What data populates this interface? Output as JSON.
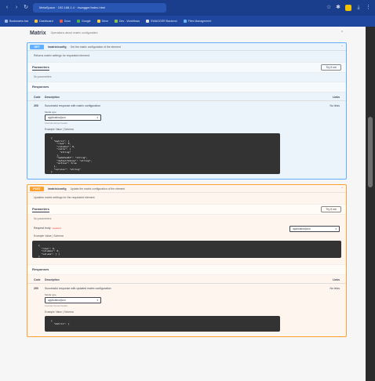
{
  "browser": {
    "tab_title": "MetaSpace · 192.168.1.4 · /swagger/index.html",
    "bookmarks": [
      {
        "label": "Bookmarks bar",
        "color": "#9fb6e6"
      },
      {
        "label": "Dashboard",
        "color": "#f4c542"
      },
      {
        "label": "Docs",
        "color": "#e25b4b"
      },
      {
        "label": "Google",
        "color": "#4caf50"
      },
      {
        "label": "Drive",
        "color": "#ffd54f"
      },
      {
        "label": "Dev - Workflows",
        "color": "#8bc34a"
      },
      {
        "label": "SWAGGER Backend",
        "color": "#e0e0e0"
      },
      {
        "label": "Files Management",
        "color": "#64b5f6"
      }
    ]
  },
  "section": {
    "title": "Matrix",
    "description": "Operations about matrix configuration"
  },
  "op_get": {
    "method": "GET",
    "path": "/matrix/config",
    "summary": "Get the matrix configuration of the element",
    "description": "Returns matrix settings for requested element.",
    "parameters_label": "Parameters",
    "try_label": "Try it out",
    "no_params": "No parameters",
    "responses_label": "Responses",
    "resp_cols": {
      "code": "Code",
      "desc": "Description",
      "links": "Links"
    },
    "resp_code": "200",
    "resp_desc": "Successful response with matrix configuration",
    "resp_links": "No links",
    "media_label": "Media type",
    "media_value": "application/json",
    "media_hint": "Controls Accept header.",
    "example_label": "Example Value | Schema",
    "code_lines": [
      "{",
      "  \"matrix\": {",
      "    \"rows\": 0,",
      "    \"columns\": 0,",
      "    \"cells\": [",
      "      \"string\"",
      "    ],",
      "    \"updatedAt\": \"string\",",
      "    \"defaultValue\": \"string\",",
      "    \"active\": true",
      "  },",
      "  \"version\": \"string\"",
      "}",
      "",
      "",
      "",
      "  ]",
      "}"
    ]
  },
  "op_post": {
    "method": "POST",
    "path": "/matrix/config",
    "summary": "Update the matrix configuration of the element",
    "description": "Updates matrix settings for the requested element.",
    "parameters_label": "Parameters",
    "try_label": "Try it out",
    "no_params": "No parameters",
    "body_label": "Request body",
    "body_required": "required",
    "body_select": "application/json",
    "example_label": "Example Value | Schema",
    "code_lines": [
      "{",
      "  \"rows\": 0,",
      "  \"columns\": 0,",
      "  \"values\": [ ]",
      "}"
    ],
    "responses_label": "Responses",
    "resp_cols": {
      "code": "Code",
      "desc": "Description",
      "links": "Links"
    },
    "resp_code": "200",
    "resp_desc": "Successful response with updated matrix configuration",
    "resp_links": "No links",
    "media_label": "Media type",
    "media_value": "application/json",
    "media_hint": "Controls Accept header.",
    "example2_label": "Example Value | Schema",
    "code2_lines": [
      "{",
      "  \"matrix\": {"
    ]
  }
}
